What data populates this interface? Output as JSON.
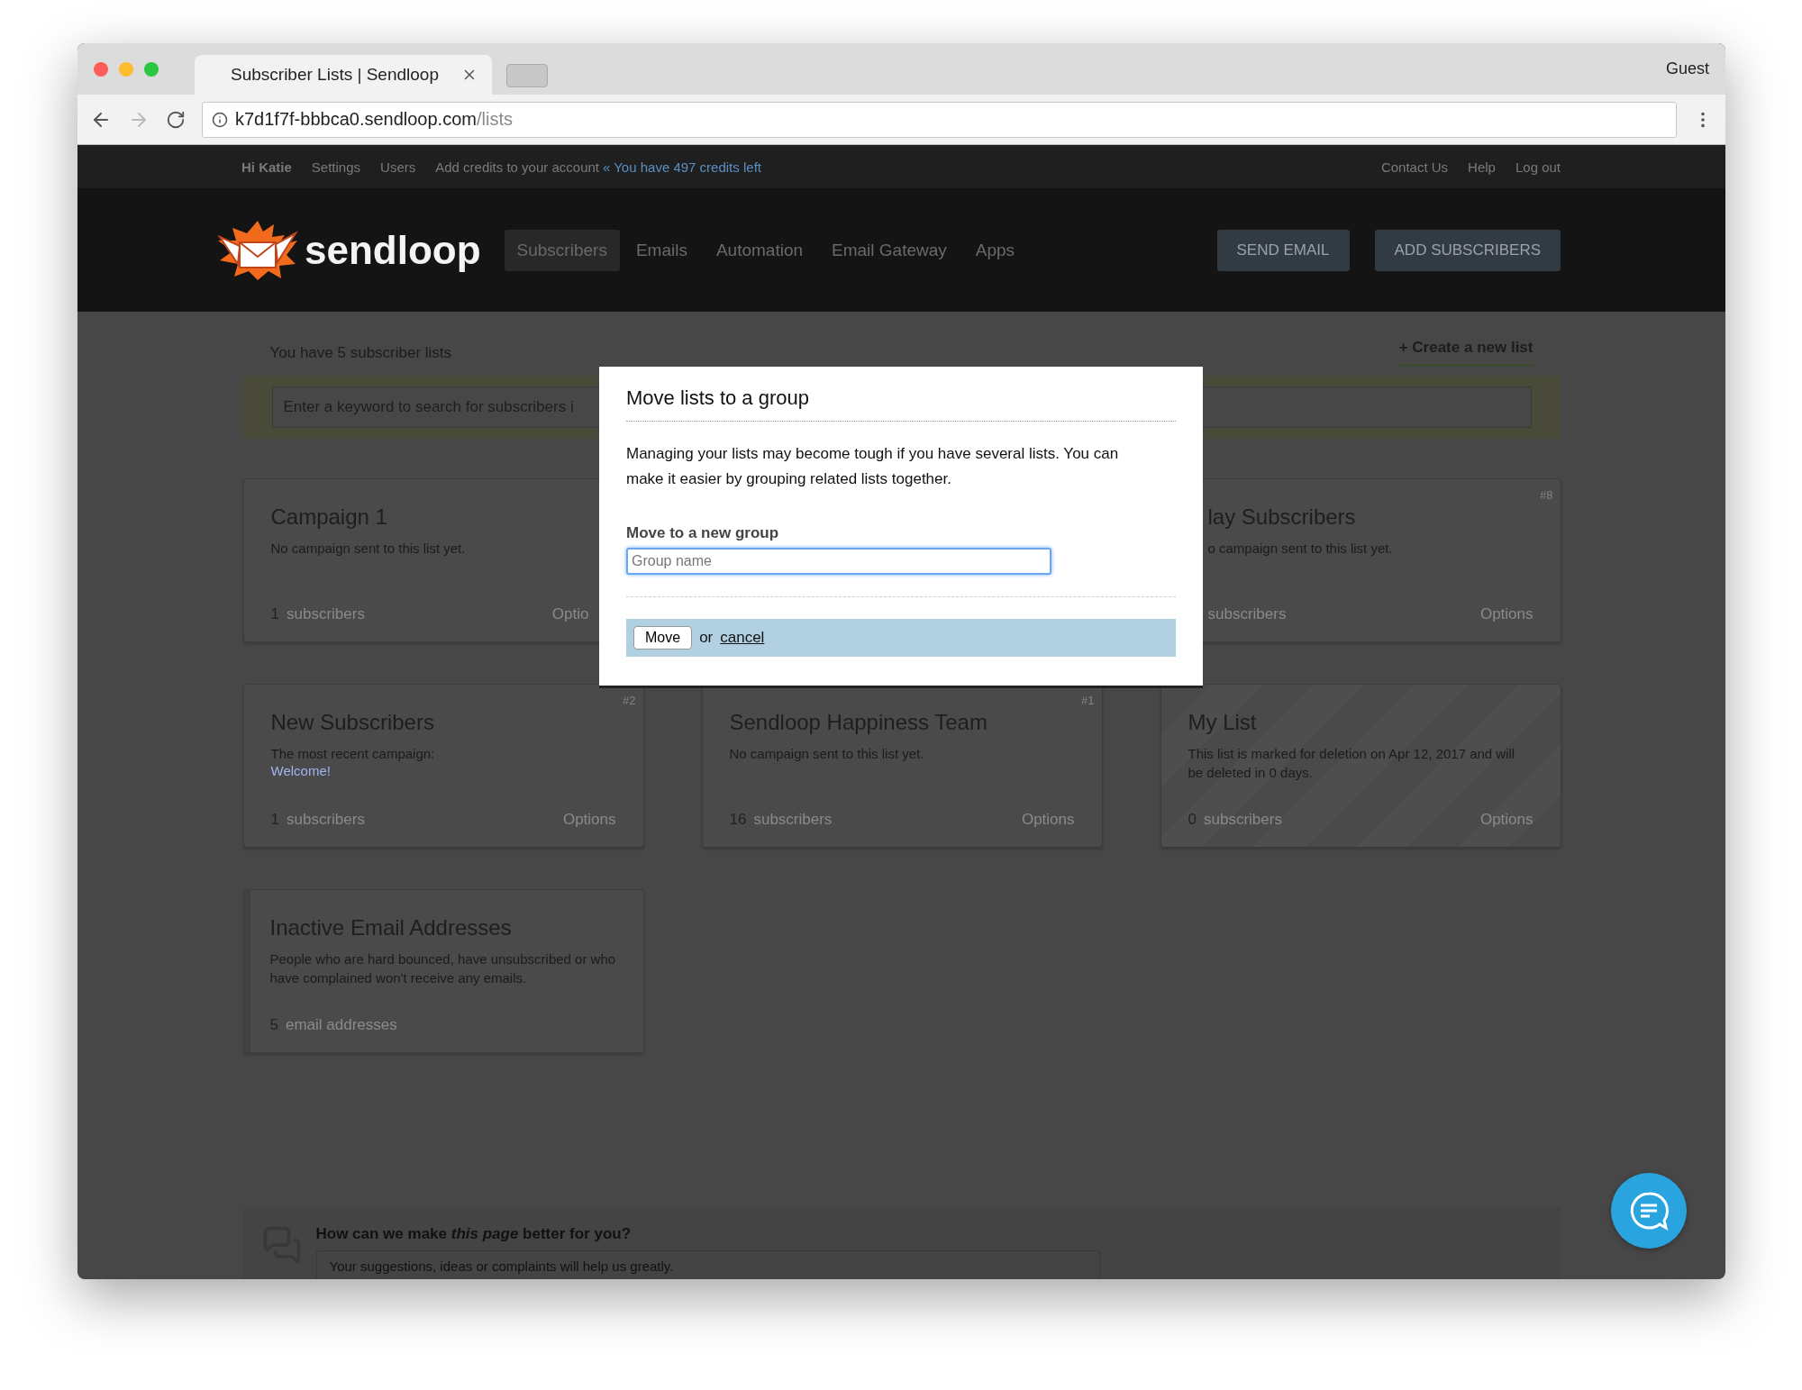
{
  "browser": {
    "tab_title": "Subscriber Lists | Sendloop",
    "profile": "Guest",
    "url_host": "k7d1f7f-bbbca0.sendloop.com",
    "url_path": "/lists"
  },
  "top_bar": {
    "greeting": "Hi Katie",
    "links": [
      "Settings",
      "Users"
    ],
    "credits_link": "Add credits to your account",
    "credits_left": "« You have 497 credits left",
    "right_links": [
      "Contact Us",
      "Help",
      "Log out"
    ]
  },
  "header": {
    "logo_text": "sendloop",
    "nav": [
      {
        "label": "Subscribers",
        "selected": true
      },
      {
        "label": "Emails",
        "selected": false
      },
      {
        "label": "Automation",
        "selected": false
      },
      {
        "label": "Email Gateway",
        "selected": false
      },
      {
        "label": "Apps",
        "selected": false
      }
    ],
    "buttons": [
      "SEND EMAIL",
      "ADD SUBSCRIBERS"
    ]
  },
  "lists_bar": {
    "summary": "You have 5 subscriber lists",
    "create_link": "+ Create a new list",
    "search_placeholder": "Enter a keyword to search for subscribers i"
  },
  "cards": [
    {
      "kind": "clipped-right",
      "title": "Campaign 1",
      "description": "No campaign sent to this list yet.",
      "count": "1",
      "count_label": "subscribers",
      "options": "Optio"
    },
    {
      "kind": "clipped-left",
      "number": "#8",
      "title": "lay Subscribers",
      "description": "o campaign sent to this list yet.",
      "count_label": "subscribers",
      "options": "Options"
    },
    {
      "kind": "full",
      "number": "#2",
      "title": "New Subscribers",
      "description": "The most recent campaign:",
      "campaign_link": "Welcome!",
      "count": "1",
      "count_label": "subscribers",
      "options": "Options"
    },
    {
      "kind": "full",
      "number": "#1",
      "title": "Sendloop Happiness Team",
      "description": "No campaign sent to this list yet.",
      "count": "16",
      "count_label": "subscribers",
      "options": "Options"
    },
    {
      "kind": "deleting",
      "title": "My List",
      "description": "This list is marked for deletion on Apr 12, 2017 and will be deleted in 0 days.",
      "count": "0",
      "count_label": "subscribers",
      "options": "Options"
    },
    {
      "kind": "system",
      "title": "Inactive Email Addresses",
      "description": "People who are hard bounced, have unsubscribed or who have complained won't receive any emails.",
      "count": "5",
      "count_label": "email addresses"
    }
  ],
  "modal": {
    "title": "Move lists to a group",
    "body": "Managing your lists may become tough if you have several lists. You can make it easier by grouping related lists together.",
    "field_label": "Move to a new group",
    "field_placeholder": "Group name",
    "button": "Move",
    "or_text": "or",
    "cancel_link": "cancel"
  },
  "feedback": {
    "question": "How can we make *this page* better for you?",
    "placeholder": "Your suggestions, ideas or complaints will help us greatly."
  }
}
